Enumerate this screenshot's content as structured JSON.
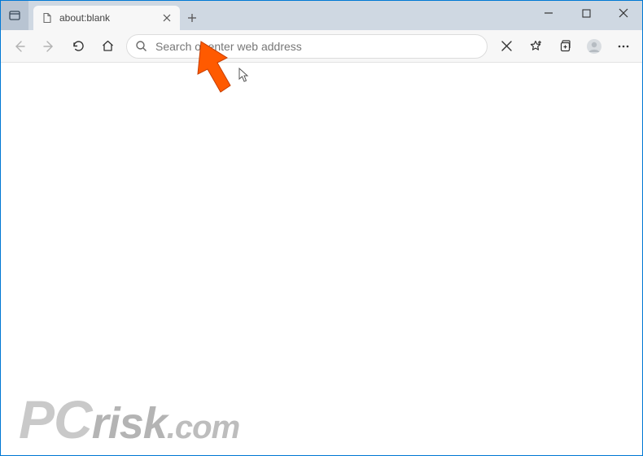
{
  "tab": {
    "title": "about:blank"
  },
  "addressbar": {
    "placeholder": "Search or enter web address",
    "value": ""
  },
  "watermark": {
    "pc": "PC",
    "risk": "risk",
    "dotcom": ".com"
  }
}
